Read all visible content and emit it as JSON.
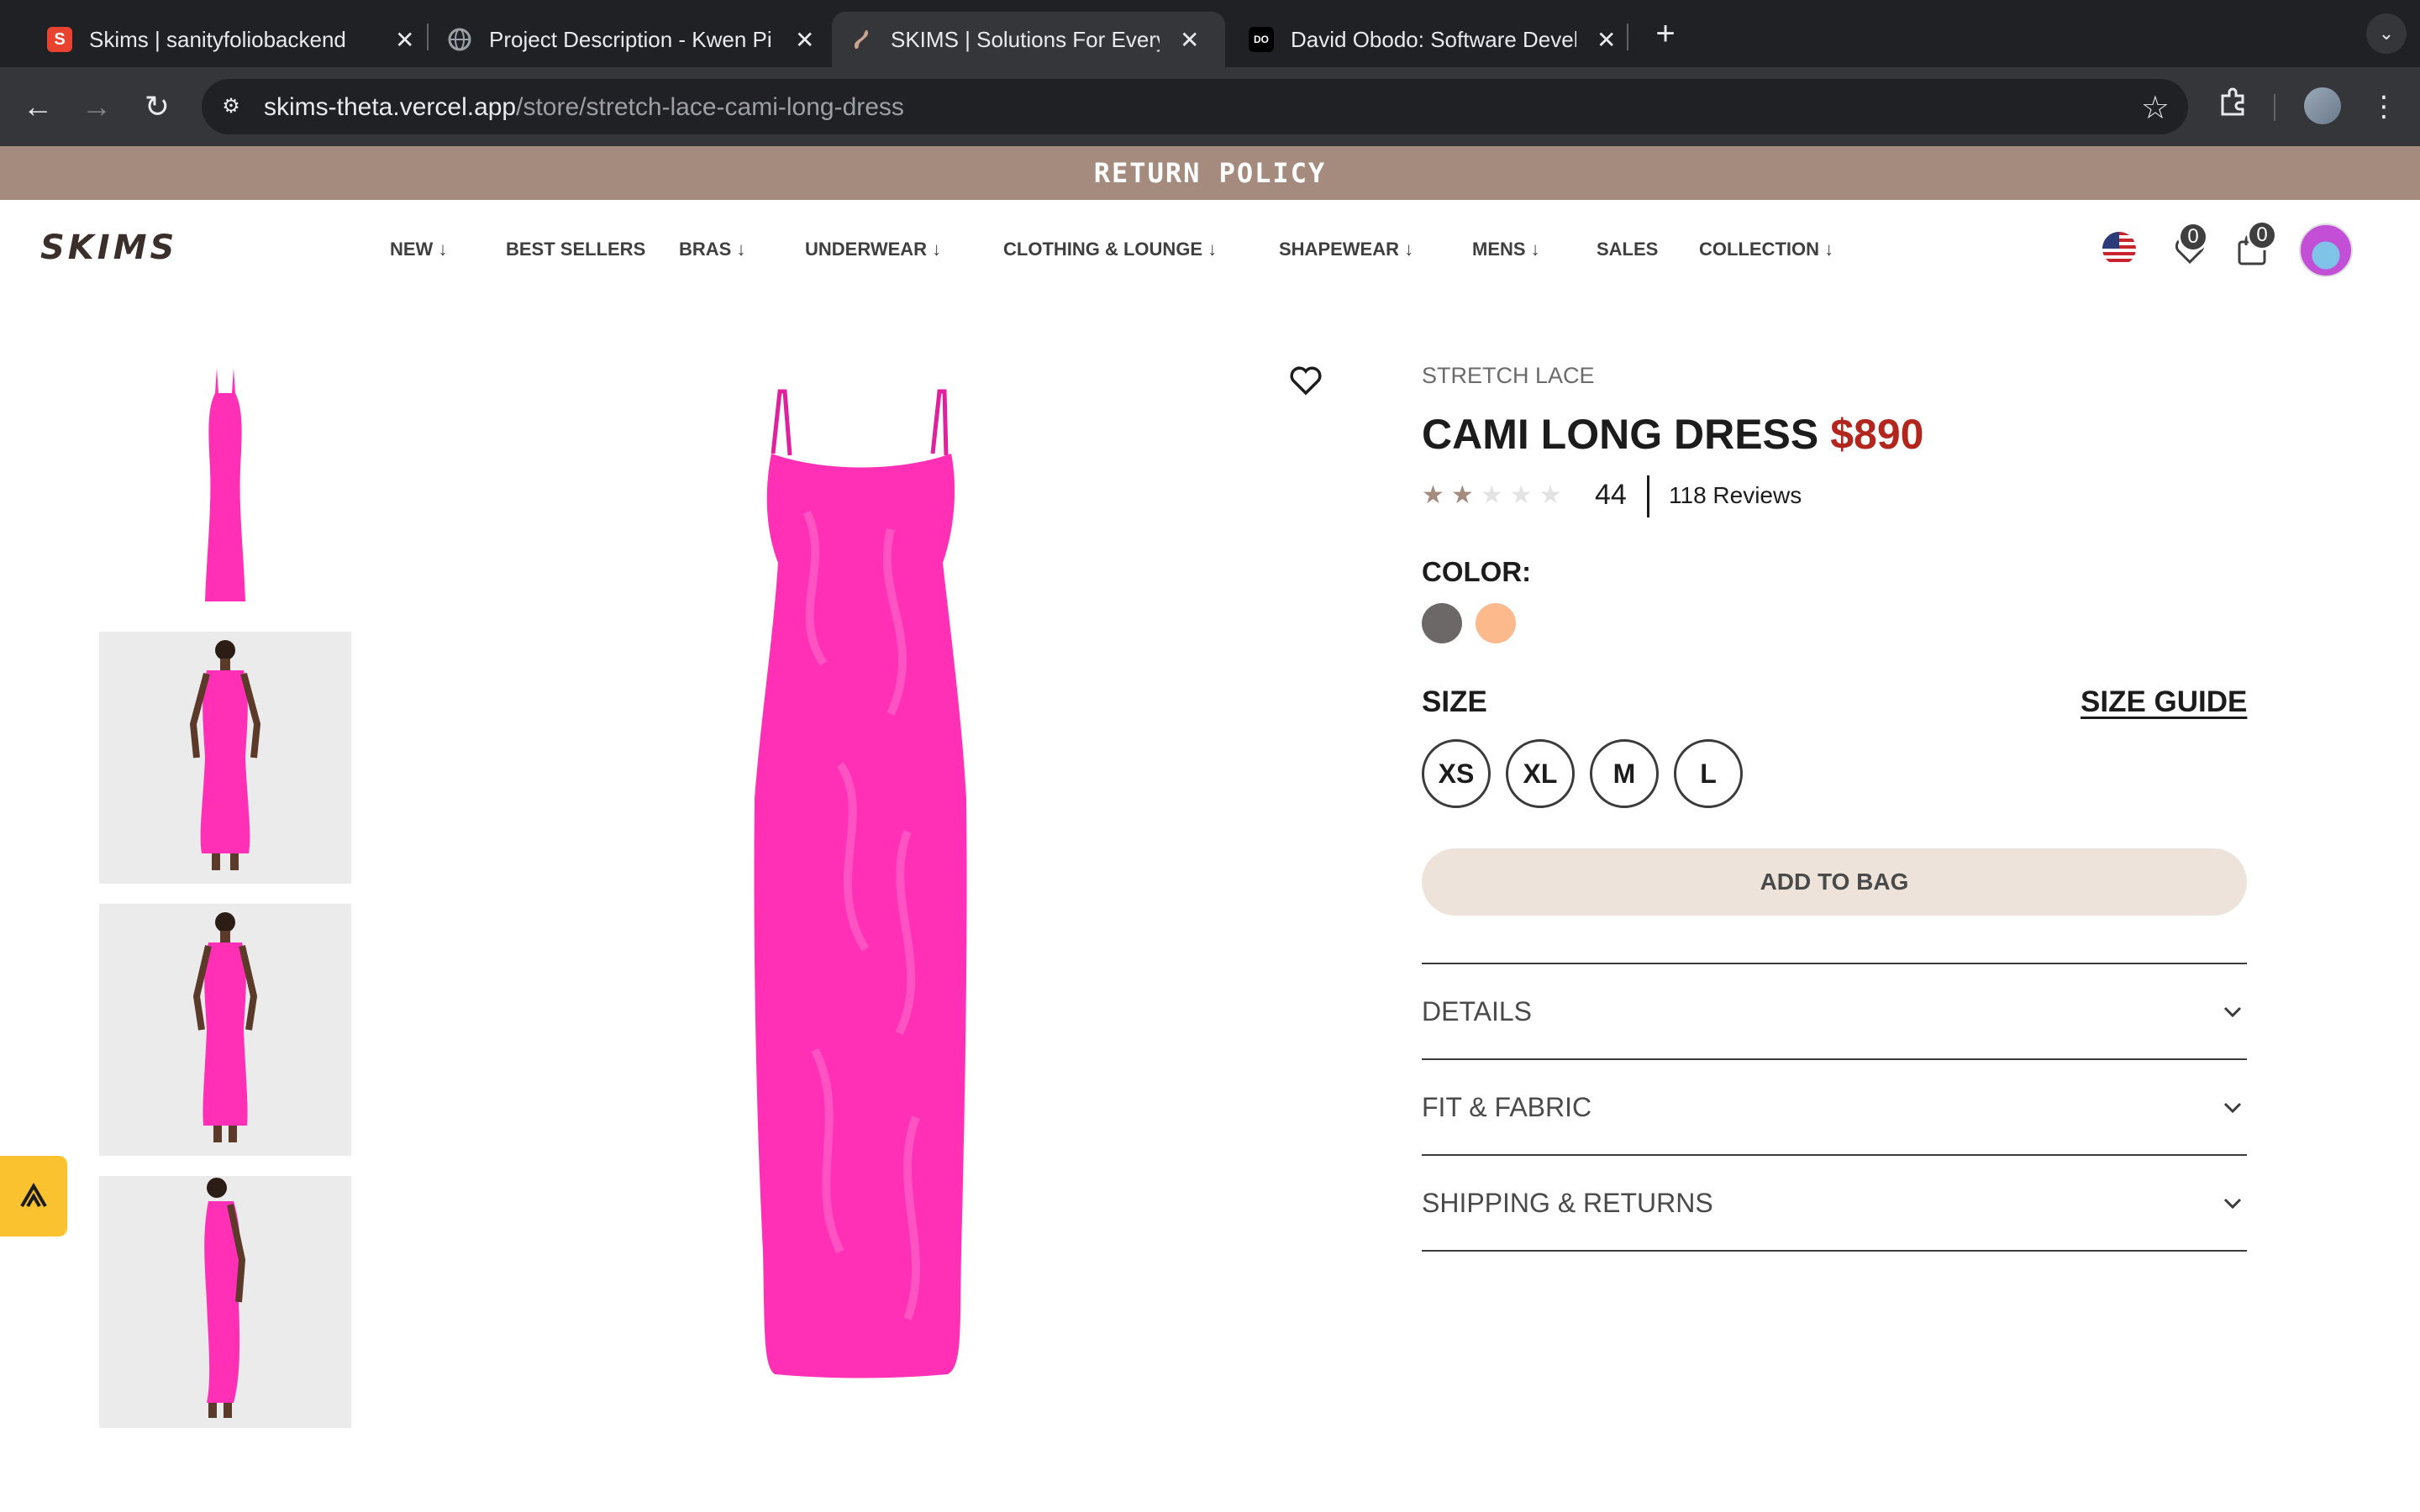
{
  "browser": {
    "tabs": [
      {
        "title": "Skims | sanityfoliobackend",
        "favicon": "S",
        "color": "#e8432e"
      },
      {
        "title": "Project Description - Kwen Pi",
        "favicon": "globe-icon",
        "color": "#5f6368"
      },
      {
        "title": "SKIMS | Solutions For Every B",
        "favicon": "skims-icon",
        "color": "#a48b7e"
      },
      {
        "title": "David Obodo: Software Devel",
        "favicon": "DO",
        "color": "#000000"
      }
    ],
    "url_host": "skims-theta.vercel.app",
    "url_path": "/store/stretch-lace-cami-long-dress"
  },
  "promo": {
    "text": "RETURN POLICY"
  },
  "header": {
    "logo": "SKIMS",
    "nav": [
      {
        "label": "NEW",
        "dropdown": true
      },
      {
        "label": "BEST SELLERS",
        "dropdown": false
      },
      {
        "label": "BRAS",
        "dropdown": true
      },
      {
        "label": "UNDERWEAR",
        "dropdown": true
      },
      {
        "label": "CLOTHING & LOUNGE",
        "dropdown": true
      },
      {
        "label": "SHAPEWEAR",
        "dropdown": true
      },
      {
        "label": "MENS",
        "dropdown": true
      },
      {
        "label": "SALES",
        "dropdown": false
      },
      {
        "label": "COLLECTION",
        "dropdown": true
      }
    ],
    "wishlist_count": "0",
    "bag_count": "0"
  },
  "product": {
    "brand": "STRETCH LACE",
    "name": "CAMI LONG DRESS",
    "price": "$890",
    "rating_stars": 2,
    "rating_count": "44",
    "reviews_label": "118 Reviews",
    "color_label": "COLOR:",
    "colors": [
      "#6b6867",
      "#fbb98c"
    ],
    "size_label": "SIZE",
    "size_guide": "SIZE GUIDE",
    "sizes": [
      "XS",
      "XL",
      "M",
      "L"
    ],
    "add_to_bag": "ADD TO BAG",
    "accordions": [
      "DETAILS",
      "FIT & FABRIC",
      "SHIPPING & RETURNS"
    ],
    "dress_color": "#ff2fb6"
  }
}
